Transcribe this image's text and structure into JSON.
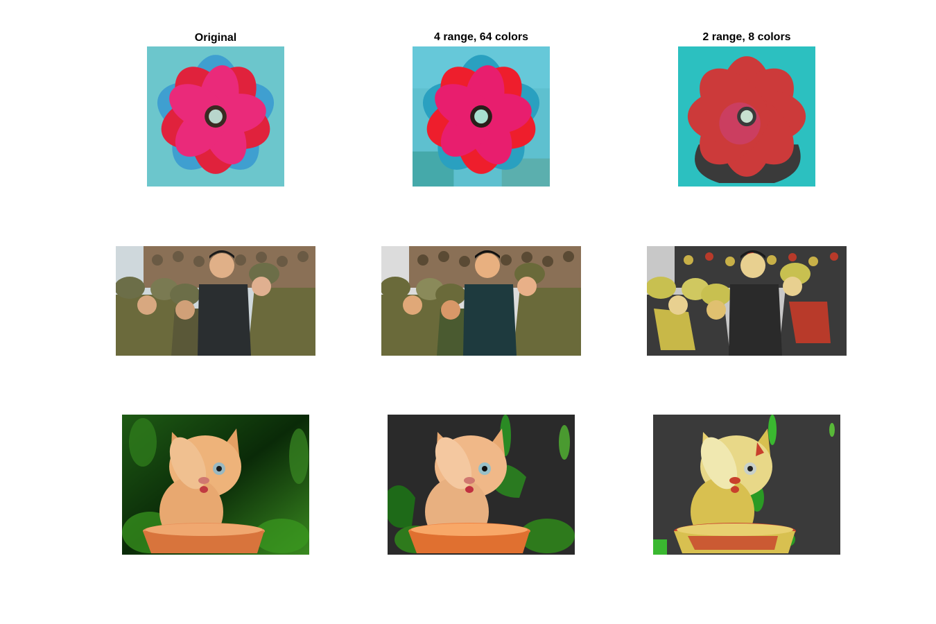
{
  "figure": {
    "titles": [
      "Original",
      "4 range, 64 colors",
      "2 range, 8 colors"
    ]
  }
}
